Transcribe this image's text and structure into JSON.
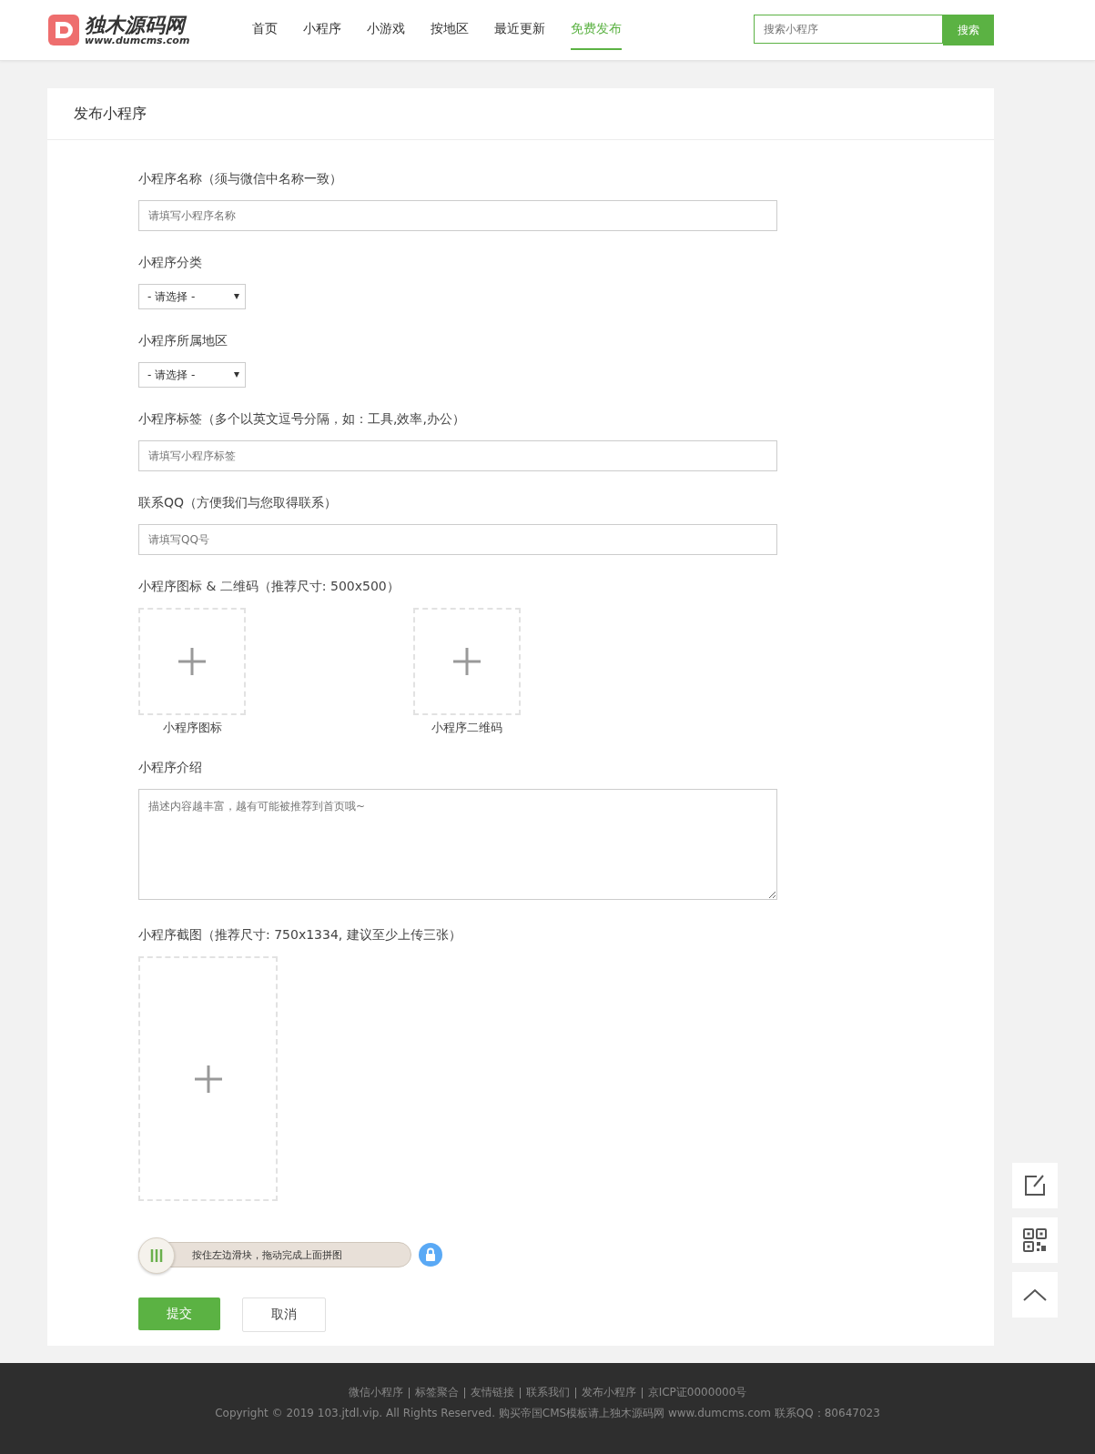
{
  "header": {
    "logo": {
      "title": "独木源码网",
      "subtitle": "www.dumcms.com"
    },
    "nav": [
      {
        "label": "首页",
        "selected": false
      },
      {
        "label": "小程序",
        "selected": false
      },
      {
        "label": "小游戏",
        "selected": false
      },
      {
        "label": "按地区",
        "selected": false
      },
      {
        "label": "最近更新",
        "selected": false
      },
      {
        "label": "免费发布",
        "selected": true
      }
    ],
    "search": {
      "placeholder": "搜索小程序",
      "button": "搜索"
    }
  },
  "form": {
    "title": "发布小程序",
    "fields": [
      {
        "kind": "text",
        "label": "小程序名称（须与微信中名称一致）",
        "placeholder": "请填写小程序名称"
      },
      {
        "kind": "select",
        "label": "小程序分类",
        "value": "- 请选择 -"
      },
      {
        "kind": "select",
        "label": "小程序所属地区",
        "value": "- 请选择 -"
      },
      {
        "kind": "text",
        "label": "小程序标签（多个以英文逗号分隔，如：工具,效率,办公）",
        "placeholder": "请填写小程序标签"
      },
      {
        "kind": "text",
        "label": "联系QQ（方便我们与您取得联系）",
        "placeholder": "请填写QQ号"
      },
      {
        "kind": "uploads",
        "label": "小程序图标 & 二维码（推荐尺寸: 500x500）",
        "items": [
          "小程序图标",
          "小程序二维码"
        ]
      },
      {
        "kind": "textarea",
        "label": "小程序介绍",
        "placeholder": "描述内容越丰富，越有可能被推荐到首页哦~"
      },
      {
        "kind": "screenshot",
        "label": "小程序截图（推荐尺寸: 750x1334, 建议至少上传三张）"
      }
    ],
    "slider": {
      "hint": "按住左边滑块，拖动完成上面拼图"
    },
    "buttons": {
      "submit": "提交",
      "cancel": "取消"
    }
  },
  "footer": {
    "links": [
      "微信小程序",
      "标签聚合",
      "友情链接",
      "联系我们",
      "发布小程序",
      "京ICP证0000000号"
    ],
    "copyright": "Copyright © 2019 103.jtdl.vip. All Rights Reserved. 购买帝国CMS模板请上独木源码网 www.dumcms.com 联系QQ：80647023"
  }
}
